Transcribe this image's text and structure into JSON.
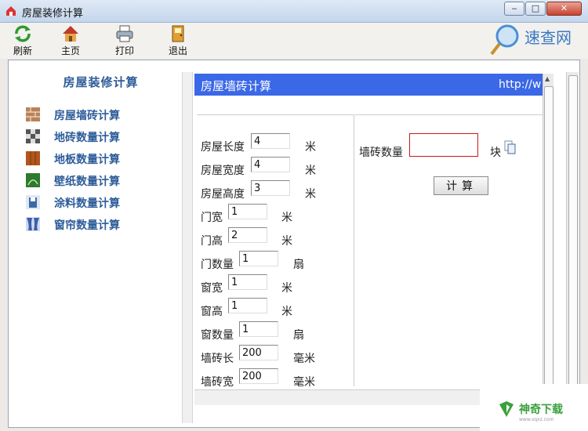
{
  "window": {
    "title": "房屋装修计算",
    "minimize_glyph": "‒",
    "maximize_glyph": "□",
    "close_glyph": "✕"
  },
  "toolbar": {
    "refresh_label": "刷新",
    "home_label": "主页",
    "print_label": "打印",
    "exit_label": "退出"
  },
  "logo": {
    "text": "速查网"
  },
  "sidebar": {
    "title": "房屋装修计算",
    "items": [
      {
        "label": "房屋墙砖计算",
        "icon": "brick-wall-icon"
      },
      {
        "label": "地砖数量计算",
        "icon": "checker-tile-icon"
      },
      {
        "label": "地板数量计算",
        "icon": "wood-floor-icon"
      },
      {
        "label": "壁纸数量计算",
        "icon": "wallpaper-icon"
      },
      {
        "label": "涂料数量计算",
        "icon": "paint-icon"
      },
      {
        "label": "窗帘数量计算",
        "icon": "curtain-icon"
      }
    ]
  },
  "content": {
    "header_title": "房屋墙砖计算",
    "header_url": "http://w",
    "fields": [
      {
        "label": "房屋长度",
        "value": "4",
        "unit": "米"
      },
      {
        "label": "房屋宽度",
        "value": "4",
        "unit": "米"
      },
      {
        "label": "房屋高度",
        "value": "3",
        "unit": "米"
      },
      {
        "label": "门宽",
        "value": "1",
        "unit": "米"
      },
      {
        "label": "门高",
        "value": "2",
        "unit": "米"
      },
      {
        "label": "门数量",
        "value": "1",
        "unit": "扇"
      },
      {
        "label": "窗宽",
        "value": "1",
        "unit": "米"
      },
      {
        "label": "窗高",
        "value": "1",
        "unit": "米"
      },
      {
        "label": "窗数量",
        "value": "1",
        "unit": "扇"
      },
      {
        "label": "墙砖长",
        "value": "200",
        "unit": "毫米"
      },
      {
        "label": "墙砖宽",
        "value": "200",
        "unit": "毫米"
      }
    ],
    "result": {
      "label": "墙砖数量",
      "value": "",
      "unit": "块",
      "button": "计算"
    }
  },
  "watermark": {
    "text": "神奇下载",
    "sub": "www.sqxz.com"
  },
  "colors": {
    "accent": "#3b68e6",
    "nav_text": "#2d5c99",
    "result_border": "#c81818"
  }
}
